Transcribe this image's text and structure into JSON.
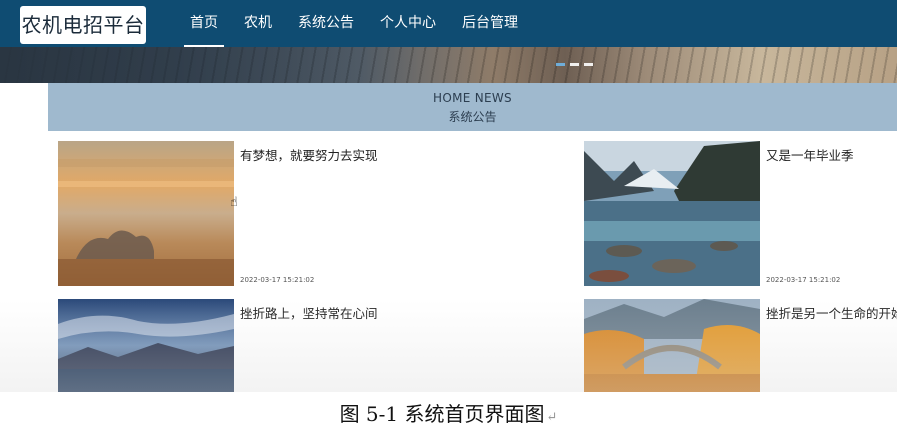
{
  "nav": {
    "logo": "农机电招平台",
    "items": [
      {
        "label": "首页",
        "active": true
      },
      {
        "label": "农机",
        "active": false
      },
      {
        "label": "系统公告",
        "active": false
      },
      {
        "label": "个人中心",
        "active": false
      },
      {
        "label": "后台管理",
        "active": false
      }
    ]
  },
  "section": {
    "title_en": "HOME NEWS",
    "title_zh": "系统公告"
  },
  "news": [
    {
      "title": "有梦想，就要努力去实现",
      "date": "2022-03-17 15:21:02"
    },
    {
      "title": "又是一年毕业季",
      "date": "2022-03-17 15:21:02"
    },
    {
      "title": "挫折路上，坚持常在心间",
      "date": ""
    },
    {
      "title": "挫折是另一个生命的开始",
      "date": ""
    }
  ],
  "caption": {
    "text": "图 5-1 系统首页界面图",
    "mark": "↵"
  },
  "colors": {
    "nav_bg": "#0f4c72",
    "band_bg": "#9fb9ce"
  }
}
